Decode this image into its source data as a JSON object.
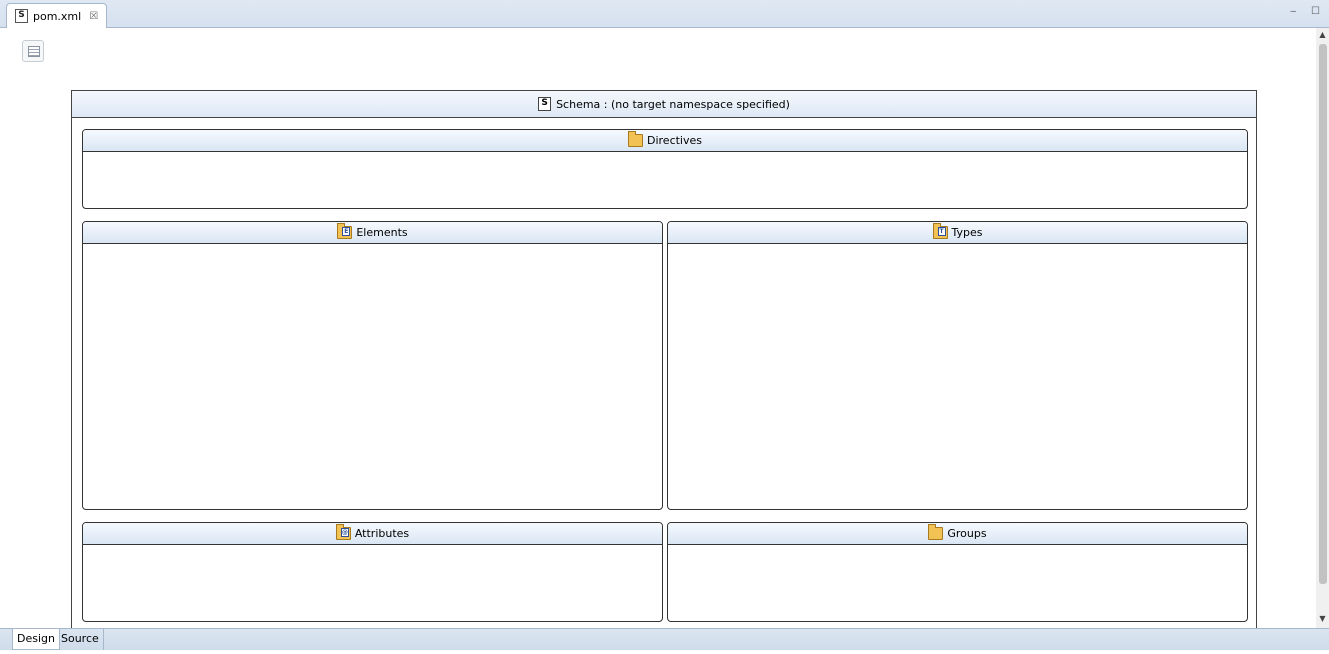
{
  "editor_tab": {
    "title": "pom.xml",
    "icon": "s-file-icon",
    "close_glyph": "☒"
  },
  "window_controls": {
    "minimize": "‒",
    "maximize": "☐"
  },
  "schema": {
    "icon_letter": "S",
    "title": "Schema : (no target namespace specified)"
  },
  "panels": {
    "directives": {
      "label": "Directives",
      "icon": "folder-open-icon"
    },
    "elements": {
      "label": "Elements",
      "icon": "element-folder-icon",
      "badge": "E"
    },
    "types": {
      "label": "Types",
      "icon": "types-folder-icon",
      "badge": "T"
    },
    "attributes": {
      "label": "Attributes",
      "icon": "attribute-folder-icon",
      "badge": "@"
    },
    "groups": {
      "label": "Groups",
      "icon": "group-folder-icon"
    }
  },
  "page_tabs": [
    {
      "label": "Design",
      "active": true
    },
    {
      "label": "Source",
      "active": false
    }
  ]
}
